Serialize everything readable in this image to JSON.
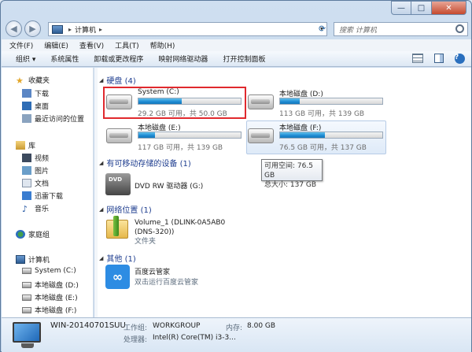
{
  "window": {
    "minimize": "—",
    "maximize": "□",
    "close": "✕"
  },
  "nav_buttons": {
    "back": "◀",
    "forward": "▶"
  },
  "address": {
    "crumb": "计算机",
    "separator": "▸",
    "dropdown": "▾",
    "refresh": "⟳"
  },
  "search": {
    "placeholder": "搜索 计算机"
  },
  "menu": [
    "文件(F)",
    "编辑(E)",
    "查看(V)",
    "工具(T)",
    "帮助(H)"
  ],
  "toolbar": {
    "organize": "组织 ▾",
    "system_props": "系统属性",
    "uninstall": "卸载或更改程序",
    "map_drive": "映射网络驱动器",
    "control_panel": "打开控制面板",
    "help": "?"
  },
  "sidebar": {
    "favorites": "收藏夹",
    "fav_items": [
      "下载",
      "桌面",
      "最近访问的位置"
    ],
    "libraries": "库",
    "lib_items": [
      "视频",
      "图片",
      "文档",
      "迅雷下载",
      "音乐"
    ],
    "homegroup": "家庭组",
    "computer": "计算机",
    "computer_items": [
      "System (C:)",
      "本地磁盘 (D:)",
      "本地磁盘 (E:)",
      "本地磁盘 (F:)"
    ]
  },
  "groups": {
    "hdd": "硬盘 (4)",
    "removable": "有可移动存储的设备 (1)",
    "network": "网络位置 (1)",
    "other": "其他 (1)"
  },
  "drives": [
    {
      "name": "System (C:)",
      "info": "29.2 GB 可用，共 50.0 GB",
      "used_fraction": 0.42
    },
    {
      "name": "本地磁盘 (D:)",
      "info": "113 GB 可用，共 139 GB",
      "used_fraction": 0.19
    },
    {
      "name": "本地磁盘 (E:)",
      "info": "117 GB 可用，共 139 GB",
      "used_fraction": 0.16
    },
    {
      "name": "本地磁盘 (F:)",
      "info": "76.5 GB 可用，共 137 GB",
      "used_fraction": 0.44
    }
  ],
  "tooltip": {
    "line1": "可用空间: 76.5 GB",
    "line2": "总大小: 137 GB"
  },
  "dvd": {
    "badge": "DVD",
    "name": "DVD RW 驱动器 (G:)"
  },
  "network_item": {
    "name_line1": "Volume_1 (DLINK-0A5AB0",
    "name_line2": "(DNS-320))",
    "type": "文件夹"
  },
  "other_item": {
    "name": "百度云管家",
    "desc": "双击运行百度云管家"
  },
  "details": {
    "computer_name": "WIN-20140701SUU",
    "workgroup_label": "工作组:",
    "workgroup": "WORKGROUP",
    "memory_label": "内存:",
    "memory": "8.00 GB",
    "cpu_label": "处理器:",
    "cpu": "Intel(R) Core(TM) i3-3..."
  },
  "colors": {
    "accent": "#1e3d8f",
    "selection_border": "#e0292e",
    "bar_fill": "#1d8ad3"
  }
}
